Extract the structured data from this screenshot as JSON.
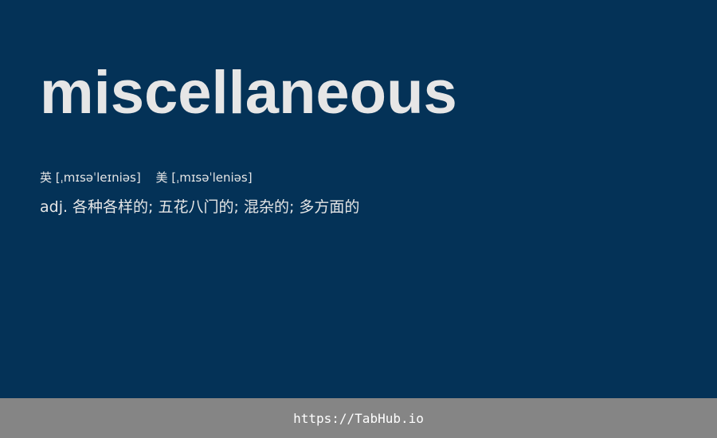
{
  "word": "miscellaneous",
  "phonetics": {
    "uk": {
      "label": "英",
      "ipa": "[ˌmɪsəˈleɪniəs]"
    },
    "us": {
      "label": "美",
      "ipa": "[ˌmɪsəˈleniəs]"
    }
  },
  "definition": "adj. 各种各样的; 五花八门的; 混杂的; 多方面的",
  "footer": {
    "link_text": "https://TabHub.io"
  },
  "colors": {
    "background": "#043257",
    "text": "#e6e6e6",
    "footer_background": "#858585",
    "footer_text": "#ffffff"
  }
}
